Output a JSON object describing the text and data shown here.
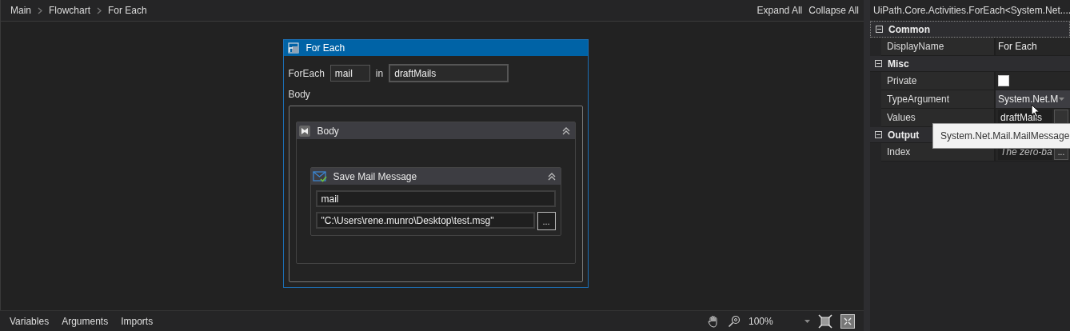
{
  "breadcrumb": [
    "Main",
    "Flowchart",
    "For Each"
  ],
  "header_actions": [
    "Expand All",
    "Collapse All"
  ],
  "for_each": {
    "title": "For Each",
    "foreach_label": "ForEach",
    "item": "mail",
    "in_label": "in",
    "values": "draftMails",
    "body_label": "Body",
    "body": {
      "title": "Body",
      "activity": {
        "title": "Save Mail Message",
        "message": "mail",
        "path": "\"C:\\Users\\rene.munro\\Desktop\\test.msg\"",
        "browse": "..."
      }
    }
  },
  "properties": {
    "title": "UiPath.Core.Activities.ForEach<System.Net....",
    "groups": [
      {
        "name": "Common",
        "expanded": true,
        "rows": [
          {
            "kind": "text",
            "name": "DisplayName",
            "value": "For Each"
          }
        ]
      },
      {
        "name": "Misc",
        "expanded": true,
        "rows": [
          {
            "kind": "checkbox",
            "name": "Private",
            "checked": false
          },
          {
            "kind": "dropdown",
            "name": "TypeArgument",
            "value": "System.Net.M"
          },
          {
            "kind": "button_field",
            "name": "Values",
            "value": "draftMails"
          }
        ]
      },
      {
        "name": "Output",
        "expanded": true,
        "rows": [
          {
            "kind": "button_field",
            "name": "Index",
            "hint": "The zero-ba",
            "button": "..."
          }
        ]
      }
    ],
    "tooltip": "System.Net.Mail.MailMessage"
  },
  "bottom_tabs": [
    "Variables",
    "Arguments",
    "Imports"
  ],
  "zoom": "100%"
}
